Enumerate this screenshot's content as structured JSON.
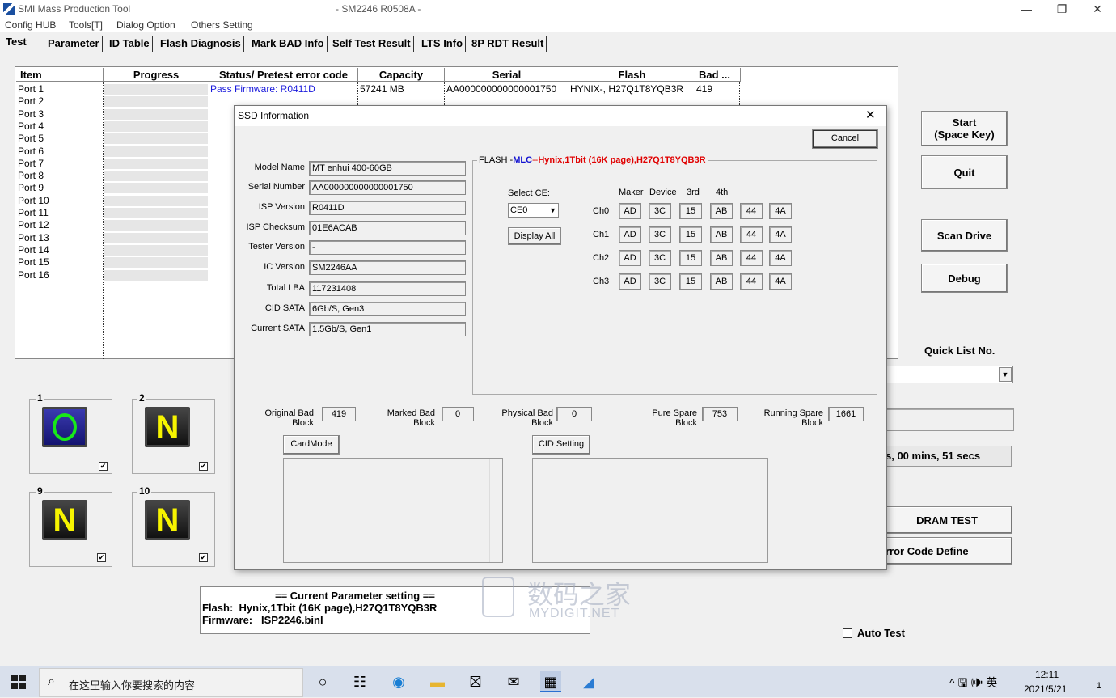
{
  "window": {
    "title": "SMI Mass Production Tool",
    "subtitle": "- SM2246 R0508A -",
    "minimize": "—",
    "restore": "❐",
    "close": "✕"
  },
  "menu": [
    "Config HUB",
    "Tools[T]",
    "Dialog Option",
    "Others Setting"
  ],
  "tabs": [
    "Test",
    "Parameter",
    "ID Table",
    "Flash Diagnosis",
    "Mark BAD Info",
    "Self Test Result",
    "LTS Info",
    "8P RDT Result"
  ],
  "grid": {
    "columns": [
      "Item",
      "Progress",
      "Status/ Pretest error code",
      "Capacity",
      "Serial",
      "Flash",
      "Bad ..."
    ],
    "ports": [
      "Port 1",
      "Port 2",
      "Port 3",
      "Port 4",
      "Port 5",
      "Port 6",
      "Port 7",
      "Port 8",
      "Port 9",
      "Port 10",
      "Port 11",
      "Port 12",
      "Port 13",
      "Port 14",
      "Port 15",
      "Port 16"
    ],
    "row1": {
      "status": "Pass   Firmware: R0411D",
      "capacity": "57241 MB",
      "serial": "AA000000000000001750",
      "flash": "HYNIX-, H27Q1T8YQB3R",
      "bad": "419"
    }
  },
  "tiles": [
    {
      "num": "1",
      "glyph": "O",
      "checked": "✔"
    },
    {
      "num": "2",
      "glyph": "N",
      "checked": "✔"
    },
    {
      "num": "9",
      "glyph": "N",
      "checked": "✔"
    },
    {
      "num": "10",
      "glyph": "N",
      "checked": "✔"
    }
  ],
  "right_panel": {
    "start": "Start",
    "start_key": "(Space Key)",
    "quit": "Quit",
    "scan": "Scan Drive",
    "debug": "Debug",
    "quick_list_label": "Quick List No.",
    "elapsed": "s, 00 mins, 51 secs",
    "dram_test": "DRAM TEST",
    "error_code": "rror Code Define",
    "auto_test": "Auto Test"
  },
  "current_param": {
    "heading": "== Current Parameter setting ==",
    "flash_label": "Flash:",
    "flash_value": "Hynix,1Tbit (16K page),H27Q1T8YQB3R",
    "fw_label": "Firmware:",
    "fw_value": "ISP2246.binl"
  },
  "watermark": {
    "cn": "数码之家",
    "en": "MYDIGIT.NET"
  },
  "dialog": {
    "title": "SSD Information",
    "cancel": "Cancel",
    "fields": [
      {
        "label": "Model Name",
        "value": "MT enhui 400-60GB"
      },
      {
        "label": "Serial Number",
        "value": "AA000000000000001750"
      },
      {
        "label": "ISP Version",
        "value": "R0411D"
      },
      {
        "label": "ISP Checksum",
        "value": "01E6ACAB"
      },
      {
        "label": "Tester Version",
        "value": "-"
      },
      {
        "label": "IC Version",
        "value": "SM2246AA"
      },
      {
        "label": "Total LBA",
        "value": "117231408"
      },
      {
        "label": "CID SATA",
        "value": "6Gb/S, Gen3"
      },
      {
        "label": "Current SATA",
        "value": "1.5Gb/S, Gen1"
      }
    ],
    "flash_group": {
      "prefix": "FLASH -",
      "type": "MLC",
      "sep": "--",
      "desc": "Hynix,1Tbit (16K page),H27Q1T8YQB3R",
      "select_ce_label": "Select CE:",
      "select_ce_value": "CE0",
      "display_all": "Display All",
      "headers": [
        "Maker",
        "Device",
        "3rd",
        "4th"
      ],
      "channels": [
        {
          "name": "Ch0",
          "values": [
            "AD",
            "3C",
            "15",
            "AB",
            "44",
            "4A"
          ]
        },
        {
          "name": "Ch1",
          "values": [
            "AD",
            "3C",
            "15",
            "AB",
            "44",
            "4A"
          ]
        },
        {
          "name": "Ch2",
          "values": [
            "AD",
            "3C",
            "15",
            "AB",
            "44",
            "4A"
          ]
        },
        {
          "name": "Ch3",
          "values": [
            "AD",
            "3C",
            "15",
            "AB",
            "44",
            "4A"
          ]
        }
      ]
    },
    "blocks": [
      {
        "label": "Original Bad Block",
        "value": "419"
      },
      {
        "label": "Marked Bad Block",
        "value": "0"
      },
      {
        "label": "Physical Bad Block",
        "value": "0"
      },
      {
        "label": "Pure Spare Block",
        "value": "753"
      },
      {
        "label": "Running Spare Block",
        "value": "1661"
      }
    ],
    "card_mode": "CardMode",
    "cid_setting": "CID Setting"
  },
  "taskbar": {
    "search_placeholder": "在这里输入你要搜索的内容",
    "tray": "^ 🖫 🕪 英",
    "time": "12:11",
    "date": "2021/5/21",
    "notif": "1"
  },
  "colors": {
    "pass_blue": "#1a1adc",
    "flash_red": "#e00000",
    "mlc_blue": "#1010d0"
  }
}
